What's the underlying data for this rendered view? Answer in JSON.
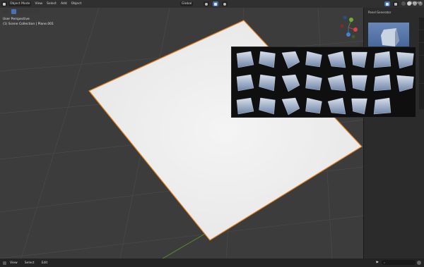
{
  "header": {
    "mode": "Object Mode",
    "menu": [
      "View",
      "Select",
      "Add",
      "Object"
    ],
    "transform_orientation": "Global",
    "options": "Options"
  },
  "viewport": {
    "perspective": "User Perspective",
    "collection": "(1) Scene Collection | Plane.001"
  },
  "sidebar": {
    "panel_title": "Panel Generator",
    "tabs": [
      "Item",
      "Tool",
      "View",
      "Photographer",
      "BlenderKit"
    ]
  },
  "gallery": {
    "thumbnail_count": 23
  },
  "footer": {
    "menu": [
      "View",
      "Select",
      "Edit"
    ]
  },
  "colors": {
    "accent": "#4772b3",
    "plane": "#f2f2f2",
    "outline": "#e07d1a",
    "axis_green": "#5a8a2a"
  }
}
